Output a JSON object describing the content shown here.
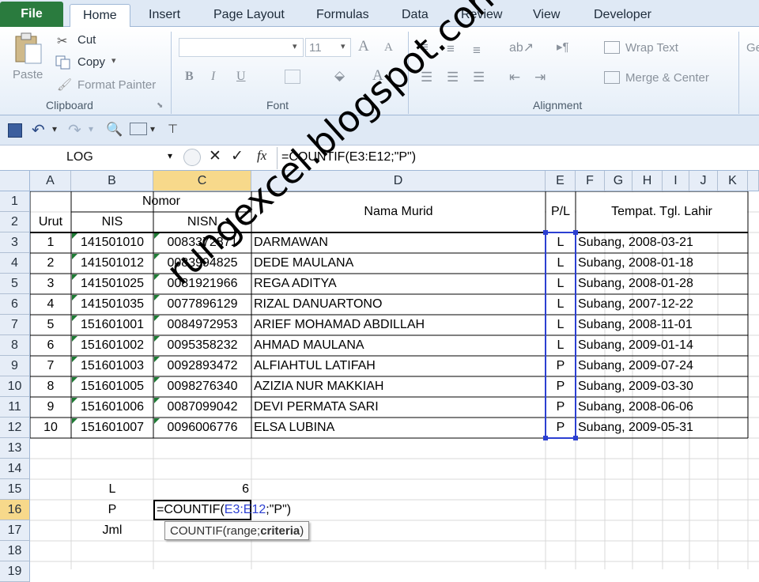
{
  "tabs": {
    "file": "File",
    "home": "Home",
    "insert": "Insert",
    "page_layout": "Page Layout",
    "formulas": "Formulas",
    "data": "Data",
    "review": "Review",
    "view": "View",
    "developer": "Developer"
  },
  "clipboard": {
    "paste": "Paste",
    "cut": "Cut",
    "copy": "Copy",
    "format_painter": "Format Painter",
    "label": "Clipboard"
  },
  "font": {
    "size": "11",
    "label": "Font",
    "bold": "B",
    "italic": "I",
    "underline": "U",
    "grow": "A",
    "shrink": "A"
  },
  "alignment": {
    "wrap_text": "Wrap Text",
    "merge_center": "Merge & Center",
    "label": "Alignment"
  },
  "number_group_cut": "Ge",
  "formula_bar": {
    "name_box": "LOG",
    "fx": "fx",
    "formula": "=COUNTIF(E3:E12;\"P\")"
  },
  "columns": [
    "A",
    "B",
    "C",
    "D",
    "E",
    "F",
    "G",
    "H",
    "I",
    "J",
    "K"
  ],
  "rows": [
    "1",
    "2",
    "3",
    "4",
    "5",
    "6",
    "7",
    "8",
    "9",
    "10",
    "11",
    "12",
    "13",
    "14",
    "15",
    "16",
    "17",
    "18",
    "19"
  ],
  "headers": {
    "nomor": "Nomor",
    "urut": "Urut",
    "nis": "NIS",
    "nisn": "NISN",
    "nama": "Nama Murid",
    "pl": "P/L",
    "ttl": "Tempat. Tgl. Lahir"
  },
  "students": [
    {
      "urut": "1",
      "nis": "141501010",
      "nisn": "0083372871",
      "nama": "DARMAWAN",
      "pl": "L",
      "ttl": "Subang, 2008-03-21"
    },
    {
      "urut": "2",
      "nis": "141501012",
      "nisn": "0083994825",
      "nama": "DEDE MAULANA",
      "pl": "L",
      "ttl": "Subang, 2008-01-18"
    },
    {
      "urut": "3",
      "nis": "141501025",
      "nisn": "0081921966",
      "nama": "REGA ADITYA",
      "pl": "L",
      "ttl": "Subang, 2008-01-28"
    },
    {
      "urut": "4",
      "nis": "141501035",
      "nisn": "0077896129",
      "nama": "RIZAL DANUARTONO",
      "pl": "L",
      "ttl": "Subang, 2007-12-22"
    },
    {
      "urut": "5",
      "nis": "151601001",
      "nisn": "0084972953",
      "nama": "ARIEF MOHAMAD ABDILLAH",
      "pl": "L",
      "ttl": "Subang, 2008-11-01"
    },
    {
      "urut": "6",
      "nis": "151601002",
      "nisn": "0095358232",
      "nama": "AHMAD MAULANA",
      "pl": "L",
      "ttl": "Subang, 2009-01-14"
    },
    {
      "urut": "7",
      "nis": "151601003",
      "nisn": "0092893472",
      "nama": "ALFIAHTUL  LATIFAH",
      "pl": "P",
      "ttl": "Subang, 2009-07-24"
    },
    {
      "urut": "8",
      "nis": "151601005",
      "nisn": "0098276340",
      "nama": "AZIZIA NUR MAKKIAH",
      "pl": "P",
      "ttl": "Subang, 2009-03-30"
    },
    {
      "urut": "9",
      "nis": "151601006",
      "nisn": "0087099042",
      "nama": "DEVI PERMATA SARI",
      "pl": "P",
      "ttl": "Subang, 2008-06-06"
    },
    {
      "urut": "10",
      "nis": "151601007",
      "nisn": "0096006776",
      "nama": "ELSA LUBINA",
      "pl": "P",
      "ttl": "Subang, 2009-05-31"
    }
  ],
  "summary": {
    "l_label": "L",
    "l_value": "6",
    "p_label": "P",
    "jml_label": "Jml"
  },
  "edit_cell": {
    "prefix": "=COUNTIF(",
    "ref": "E3:E12",
    "suffix": ";\"P\")"
  },
  "tooltip": {
    "func": "COUNTIF(range; ",
    "arg": "criteria",
    "close": ")"
  },
  "watermark": "rungexcel.blogspot.com",
  "colors": {
    "file_tab": "#2a7b3e",
    "selected_header": "#f7d98b",
    "range_ref": "#2b3fd1",
    "ribbon": "#dfe9f5"
  }
}
